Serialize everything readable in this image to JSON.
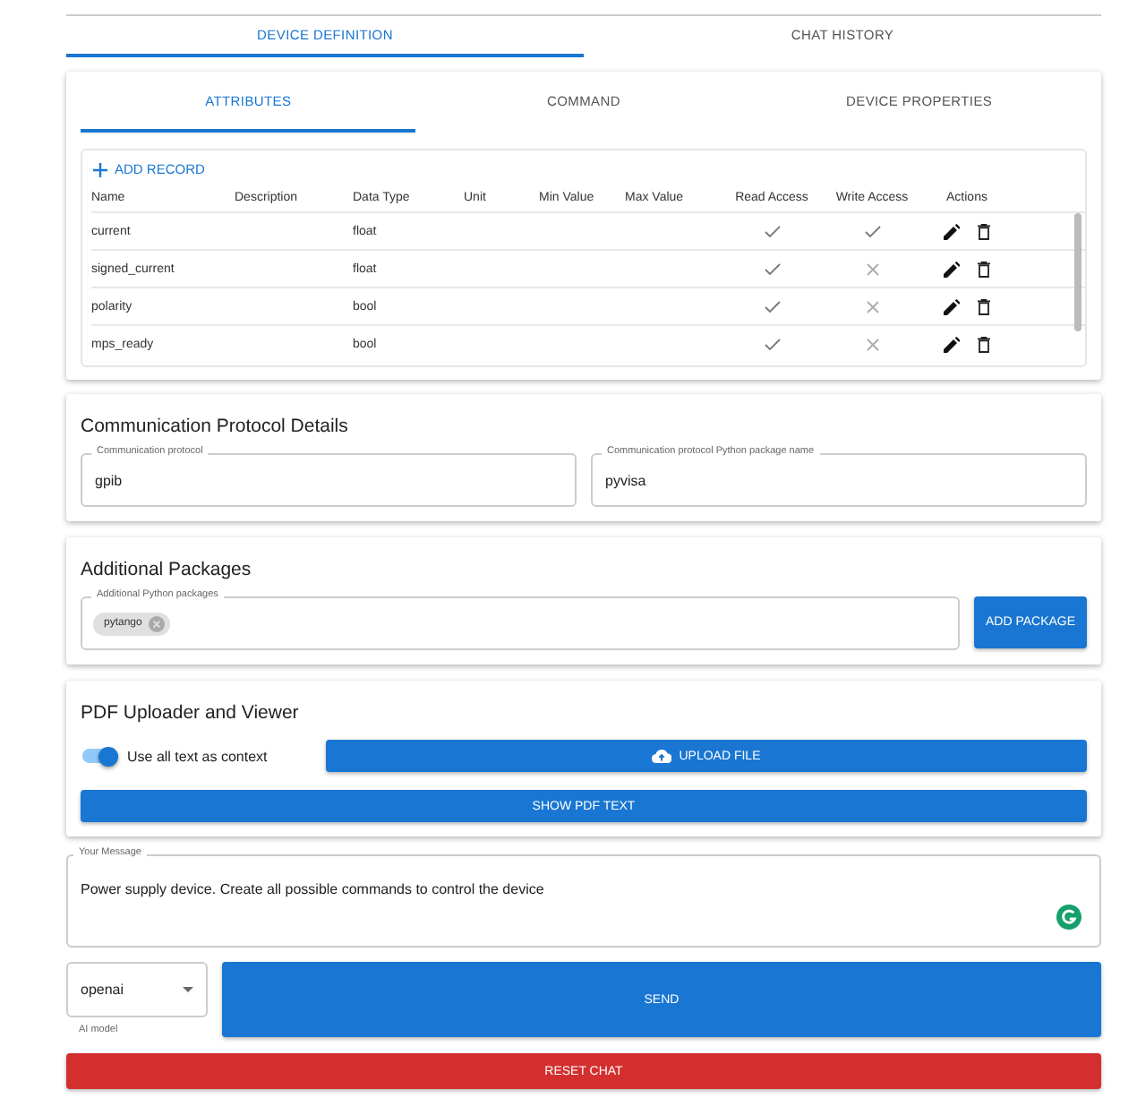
{
  "tabs": [
    {
      "label": "DEVICE DEFINITION",
      "selected": true
    },
    {
      "label": "CHAT HISTORY",
      "selected": false
    }
  ],
  "subtabs": [
    {
      "label": "ATTRIBUTES",
      "selected": true
    },
    {
      "label": "COMMAND",
      "selected": false
    },
    {
      "label": "DEVICE PROPERTIES",
      "selected": false
    }
  ],
  "table": {
    "add_label": "ADD RECORD",
    "columns": [
      "Name",
      "Description",
      "Data Type",
      "Unit",
      "Min Value",
      "Max Value",
      "Read Access",
      "Write Access",
      "Actions"
    ],
    "rows": [
      {
        "name": "current",
        "data_type": "float",
        "read_access": true,
        "write_access": true
      },
      {
        "name": "signed_current",
        "data_type": "float",
        "read_access": true,
        "write_access": false
      },
      {
        "name": "polarity",
        "data_type": "bool",
        "read_access": true,
        "write_access": false
      },
      {
        "name": "mps_ready",
        "data_type": "bool",
        "read_access": true,
        "write_access": false
      }
    ]
  },
  "protocol": {
    "title": "Communication Protocol Details",
    "fields": [
      {
        "label": "Communication protocol",
        "value": "gpib"
      },
      {
        "label": "Communication protocol Python package name",
        "value": "pyvisa"
      }
    ]
  },
  "packages": {
    "title": "Additional Packages",
    "field_label": "Additional Python packages",
    "chips": [
      "pytango"
    ],
    "button": "ADD PACKAGE"
  },
  "pdf": {
    "title": "PDF Uploader and Viewer",
    "toggle": {
      "label": "Use all text as context",
      "on": true
    },
    "upload_button": "UPLOAD FILE",
    "show_button": "SHOW PDF TEXT"
  },
  "message": {
    "label": "Your Message",
    "value": "Power supply device. Create all possible commands to control the device"
  },
  "model": {
    "value": "openai",
    "helper": "AI model"
  },
  "send_button": "SEND",
  "reset_button": "RESET CHAT"
}
